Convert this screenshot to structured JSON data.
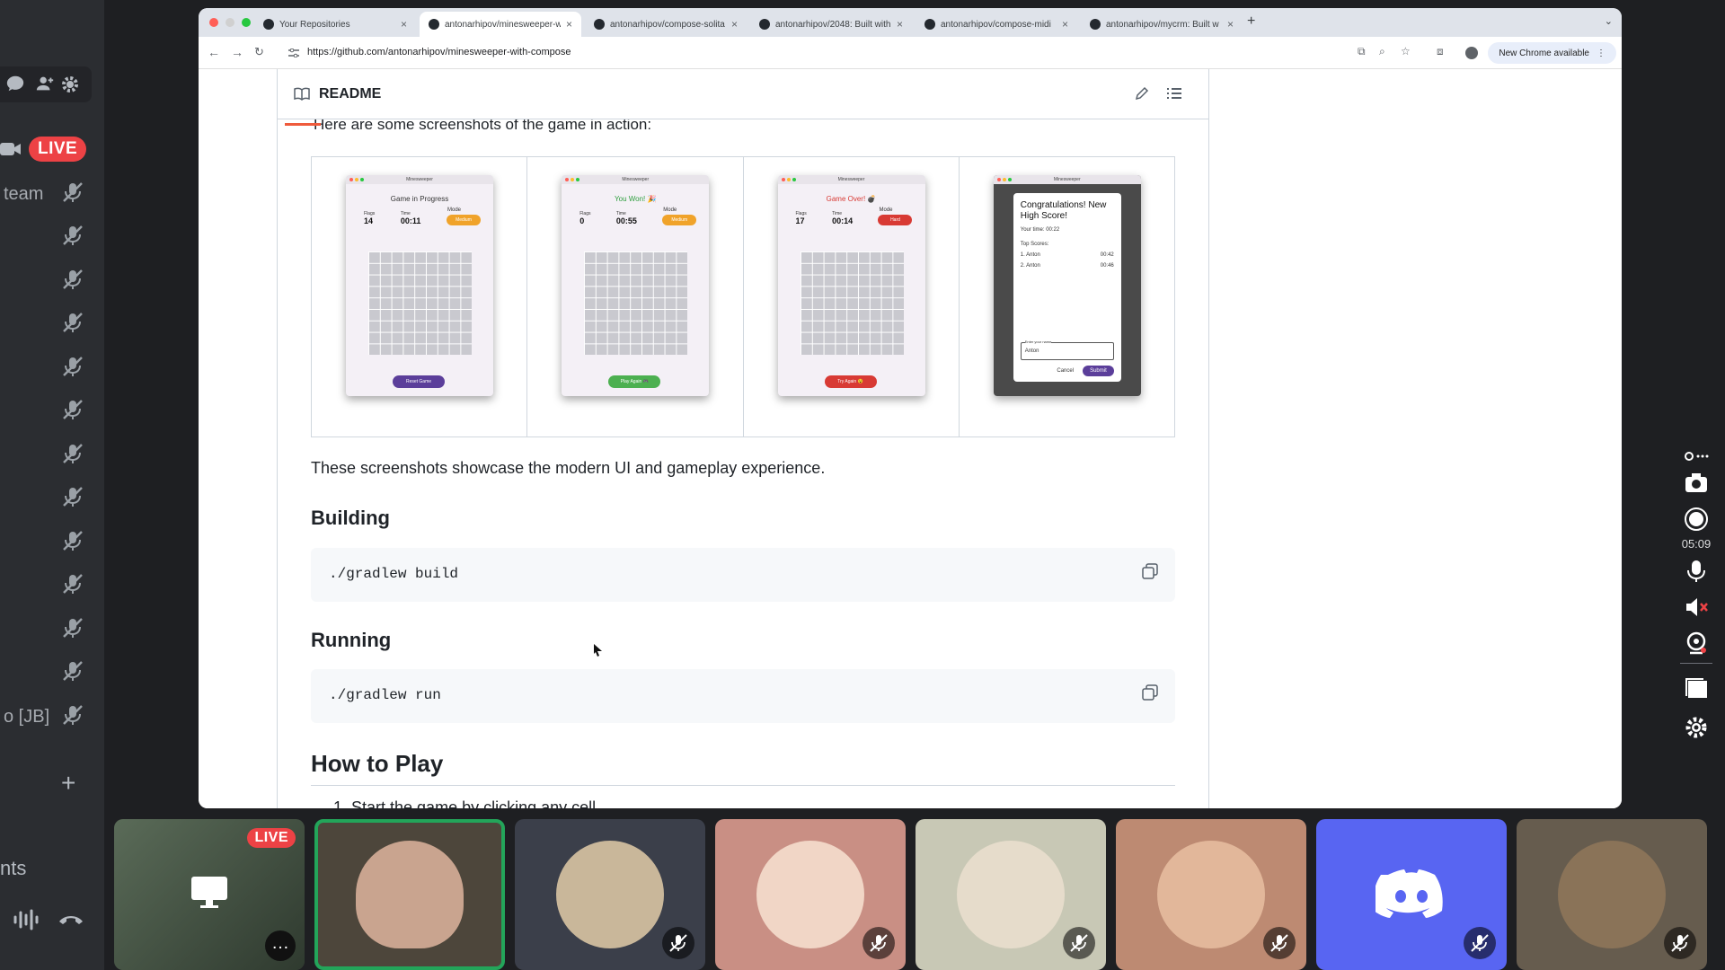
{
  "discord": {
    "live_label": "LIVE",
    "channel_rows": [
      "team",
      "",
      "",
      "",
      "",
      "",
      "",
      "",
      "",
      "",
      "",
      "",
      "o [JB]"
    ],
    "bottom_label": "nts",
    "add_label": "+",
    "rail_timer": "05:09",
    "tiles": [
      {
        "kind": "screen",
        "bg": "#3a4a3a",
        "live": "LIVE"
      },
      {
        "kind": "speaker",
        "bg": "#4d463b",
        "speaking": true
      },
      {
        "kind": "avatar",
        "bg": "#3b3f4a",
        "avatar": "#c9b79a"
      },
      {
        "kind": "avatar",
        "bg": "#c98f84",
        "avatar": "#f1d6c6"
      },
      {
        "kind": "avatar",
        "bg": "#c8c8b5",
        "avatar": "#e6dccb"
      },
      {
        "kind": "avatar",
        "bg": "#bd8a72",
        "avatar": "#e2b79a"
      },
      {
        "kind": "discord",
        "bg": "#5865f2"
      },
      {
        "kind": "avatar",
        "bg": "#665c4e",
        "avatar": "#8a7358"
      }
    ]
  },
  "browser": {
    "tabs": [
      {
        "title": "Your Repositories",
        "active": false
      },
      {
        "title": "antonarhipov/minesweeper-w",
        "active": true
      },
      {
        "title": "antonarhipov/compose-solita",
        "active": false
      },
      {
        "title": "antonarhipov/2048: Built with",
        "active": false
      },
      {
        "title": "antonarhipov/compose-midi",
        "active": false
      },
      {
        "title": "antonarhipov/mycrm: Built w",
        "active": false
      }
    ],
    "new_tab": "+",
    "url": "https://github.com/antonarhipov/minesweeper-with-compose",
    "new_chrome": "New Chrome available"
  },
  "readme": {
    "header": "README",
    "intro_clipped": "Here are some screenshots of the game in action:",
    "screens": [
      {
        "app": "Minesweeper",
        "status": "Game in Progress",
        "status_color": "#333333",
        "flags": "14",
        "time": "00:11",
        "mode": "Medium",
        "mode_color": "#f0a32a",
        "button": "Reset Game",
        "button_color": "#5b3e9a"
      },
      {
        "app": "Minesweeper",
        "status": "You Won! 🎉",
        "status_color": "#2e9e3e",
        "flags": "0",
        "time": "00:55",
        "mode": "Medium",
        "mode_color": "#f0a32a",
        "button": "Play Again 🎮",
        "button_color": "#4cb050"
      },
      {
        "app": "Minesweeper",
        "status": "Game Over! 💣",
        "status_color": "#d83a34",
        "flags": "17",
        "time": "00:14",
        "mode": "Hard",
        "mode_color": "#d83a34",
        "button": "Try Again 😵",
        "button_color": "#d83a34"
      }
    ],
    "labels": {
      "flags": "Flags",
      "time": "Time",
      "mode": "Mode"
    },
    "dialog": {
      "app": "Minesweeper",
      "title": "Congratulations! New High Score!",
      "your_time": "Your time: 00:22",
      "top_scores": "Top Scores:",
      "scores": [
        {
          "rank": "1.",
          "name": "Anton",
          "time": "00:42"
        },
        {
          "rank": "2.",
          "name": "Anton",
          "time": "00:46"
        }
      ],
      "input_label": "Enter your name",
      "input_value": "Anton",
      "cancel": "Cancel",
      "submit": "Submit"
    },
    "summary": "These screenshots showcase the modern UI and gameplay experience.",
    "building_heading": "Building",
    "build_cmd": "./gradlew build",
    "running_heading": "Running",
    "run_cmd": "./gradlew run",
    "howto_heading": "How to Play",
    "howto_first_clipped": "1. Start the game by clicking any cell"
  }
}
